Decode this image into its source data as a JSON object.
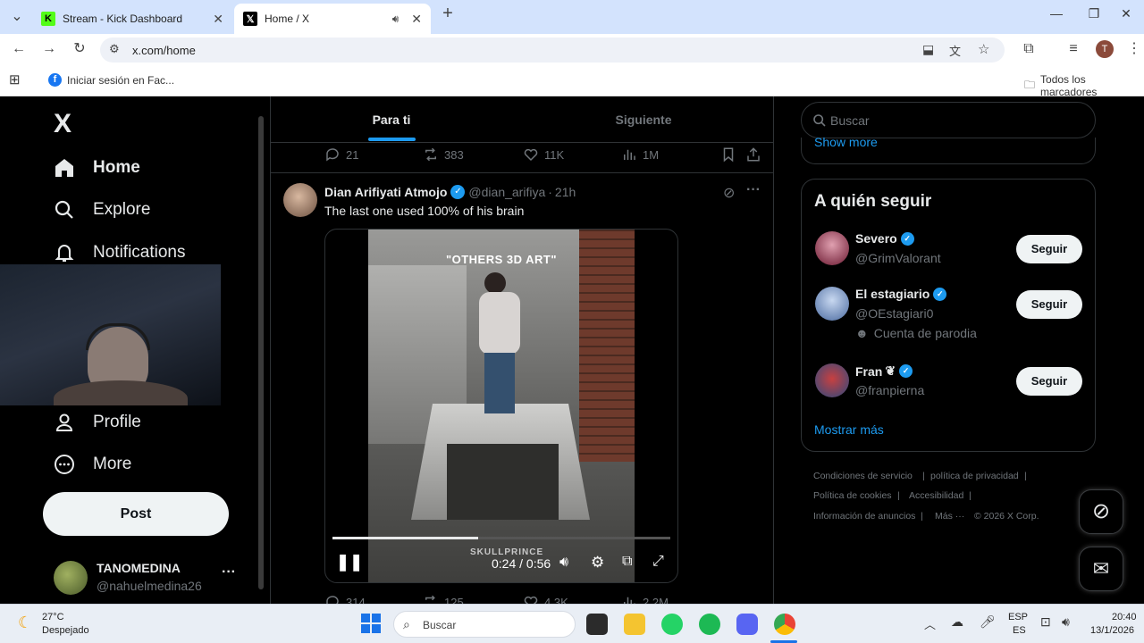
{
  "browser": {
    "tabs": [
      {
        "label": "Stream - Kick Dashboard",
        "active": false
      },
      {
        "label": "Home / X",
        "active": true
      }
    ],
    "url": "x.com/home",
    "profile_initial": "T",
    "bookmarks": [
      {
        "label": "Iniciar sesión en Fac..."
      }
    ],
    "all_bookmarks_label": "Todos los marcadores"
  },
  "sidebar": {
    "logo": "X",
    "nav": [
      {
        "label": "Home",
        "icon": "home-icon"
      },
      {
        "label": "Explore",
        "icon": "search-icon"
      },
      {
        "label": "Notifications",
        "icon": "bell-icon"
      },
      {
        "label": "Profile",
        "icon": "person-icon"
      },
      {
        "label": "More",
        "icon": "more-circle-icon"
      }
    ],
    "post_label": "Post",
    "account": {
      "name": "TANOMEDINA",
      "handle": "@nahuelmedina26"
    }
  },
  "feed": {
    "tabs": [
      "Para ti",
      "Siguiente"
    ],
    "prev_post_actions": {
      "replies": "21",
      "reposts": "383",
      "likes": "11K",
      "views": "1M"
    },
    "post": {
      "author": "Dian Arifiyati Atmojo",
      "handle": "@dian_arifiya",
      "time": "21h",
      "separator": "·",
      "text": "The last one used 100% of his brain",
      "video": {
        "overlay_text": "\"OTHERS 3D ART\"",
        "watermark": "SKULLPRINCE",
        "current_time": "0:24",
        "duration": "0:56",
        "progress": 0.43
      }
    },
    "next_post_actions": {
      "replies": "314",
      "reposts": "125",
      "likes": "4.3K",
      "views": "2.2M"
    }
  },
  "right": {
    "search_placeholder": "Buscar",
    "show_more_top": "Show more",
    "who_to_follow_title": "A quién seguir",
    "follow_button": "Seguir",
    "suggestions": [
      {
        "name": "Severo",
        "handle": "@GrimValorant",
        "verified": true,
        "extra": ""
      },
      {
        "name": "El estagiario",
        "handle": "@OEstagiari0",
        "verified": true,
        "extra": "Cuenta de parodia"
      },
      {
        "name": "Fran",
        "handle": "@franpierna",
        "verified": true,
        "extra": ""
      }
    ],
    "show_more": "Mostrar más",
    "footer": [
      "Condiciones de servicio",
      "política de privacidad",
      "Política de cookies",
      "Accesibilidad",
      "Información de anuncios",
      "Más ···",
      "© 2026 X Corp."
    ]
  },
  "taskbar": {
    "weather_temp": "27°C",
    "weather_desc": "Despejado",
    "search_placeholder": "Buscar",
    "lang_top": "ESP",
    "lang_bottom": "ES",
    "time": "20:40",
    "date": "13/1/2026"
  },
  "colors": {
    "accent": "#1d9bf0",
    "tab_strip": "#d3e3fd",
    "x_bg": "#000000",
    "muted": "#71767b",
    "text": "#e7e9ea"
  }
}
